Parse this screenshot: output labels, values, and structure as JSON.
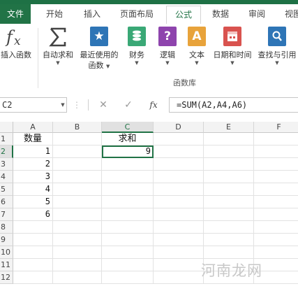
{
  "tabs": [
    {
      "label": "文件"
    },
    {
      "label": "开始"
    },
    {
      "label": "插入"
    },
    {
      "label": "页面布局"
    },
    {
      "label": "公式"
    },
    {
      "label": "数据"
    },
    {
      "label": "审阅"
    },
    {
      "label": "视图"
    }
  ],
  "active_tab": "公式",
  "ribbon": {
    "buttons": [
      {
        "label": "插入函数",
        "icon": "fx-icon"
      },
      {
        "label": "自动求和",
        "icon": "sigma-icon"
      },
      {
        "label": "最近使用的",
        "label2": "函数",
        "icon": "star-book-icon"
      },
      {
        "label": "财务",
        "icon": "coins-book-icon"
      },
      {
        "label": "逻辑",
        "icon": "question-book-icon"
      },
      {
        "label": "文本",
        "icon": "text-book-icon"
      },
      {
        "label": "日期和时间",
        "icon": "calendar-book-icon"
      },
      {
        "label": "查找与引用",
        "icon": "search-book-icon"
      }
    ],
    "group_label": "函数库",
    "colors": {
      "blue": "#2e75b6",
      "green": "#3aa876",
      "purple": "#8e44ad",
      "orange": "#e8a33b",
      "red": "#d9534f"
    }
  },
  "formula_bar": {
    "name_box": "C2",
    "cancel_symbol": "✕",
    "enter_symbol": "✓",
    "fx_symbol": "fx",
    "formula": "=SUM(A2,A4,A6)"
  },
  "sheet": {
    "columns": [
      "A",
      "B",
      "C",
      "D",
      "E",
      "F"
    ],
    "rows": [
      "1",
      "2",
      "3",
      "4",
      "5",
      "6",
      "7",
      "8",
      "9",
      "10",
      "11",
      "12"
    ],
    "selected_cell": "C2",
    "cells": {
      "A1": "数量",
      "A2": "1",
      "A3": "2",
      "A4": "3",
      "A5": "4",
      "A6": "5",
      "A7": "6",
      "C1": "求和",
      "C2": "9"
    }
  },
  "watermark": "河南龙网",
  "accent_color": "#217346"
}
